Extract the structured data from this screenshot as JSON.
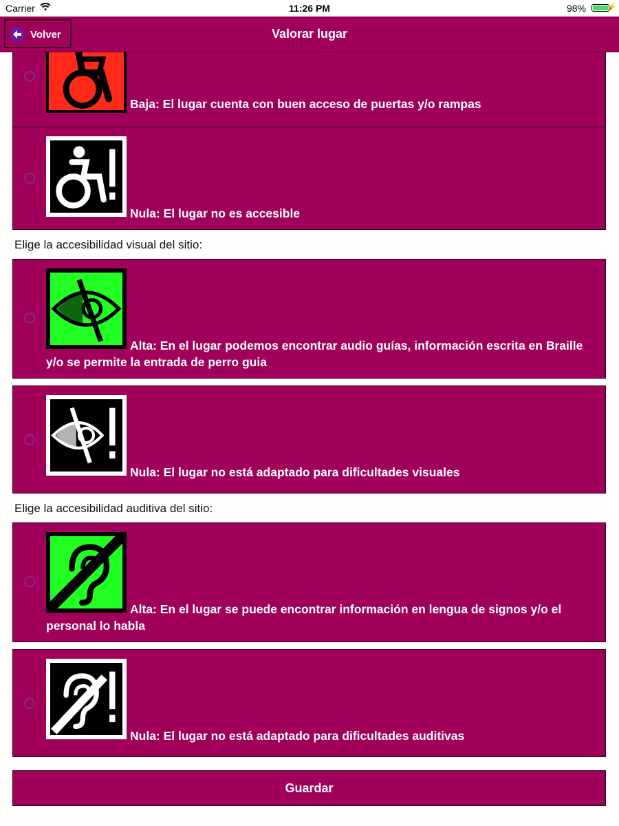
{
  "status_bar": {
    "carrier": "Carrier",
    "time": "11:26 PM",
    "battery": "98%"
  },
  "header": {
    "back_label": "Volver",
    "title": "Valorar lugar"
  },
  "sections": {
    "motor": {
      "options": [
        {
          "text": "Baja: El lugar cuenta con buen acceso de puertas y/o rampas",
          "icon": "wheelchair-red-icon",
          "color": "#ff2a1a"
        },
        {
          "text": "Nula: El lugar no es accesible",
          "icon": "wheelchair-no-access-icon",
          "color": "#ffffff"
        }
      ]
    },
    "visual": {
      "label": "Elige la accesibilidad visual del sitio:",
      "options": [
        {
          "text": "Alta: En el lugar podemos encontrar audio guías, información escrita en Braille y/o se permite la entrada de perro guia",
          "icon": "low-vision-green-icon",
          "color": "#22ff22"
        },
        {
          "text": "Nula: El lugar no está adaptado para dificultades visuales",
          "icon": "low-vision-no-access-icon",
          "color": "#ffffff"
        }
      ]
    },
    "auditory": {
      "label": "Elige la accesibilidad auditiva del sitio:",
      "options": [
        {
          "text": "Alta: En el lugar se puede encontrar información en lengua de signos y/o el personal lo habla",
          "icon": "hearing-green-icon",
          "color": "#22ff22"
        },
        {
          "text": "Nula: El lugar no está adaptado para dificultades auditivas",
          "icon": "hearing-no-access-icon",
          "color": "#ffffff"
        }
      ]
    }
  },
  "save_label": "Guardar",
  "colors": {
    "accent": "#a0005a",
    "radio": "#7a3a9c"
  }
}
